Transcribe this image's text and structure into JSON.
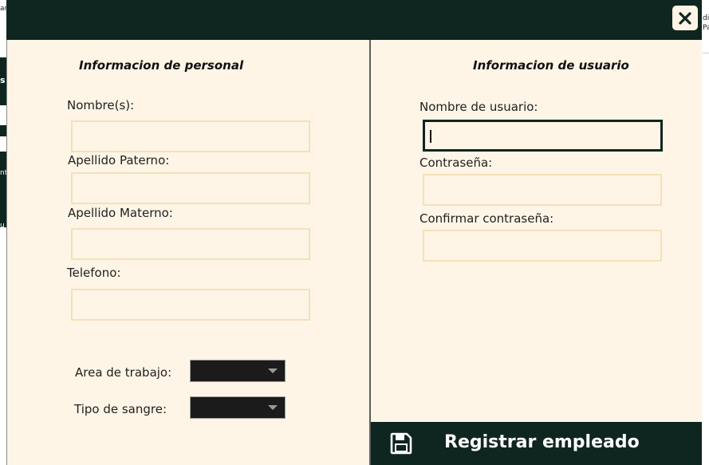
{
  "background": {
    "snippets": [
      "ar",
      "di",
      "Pa",
      "s",
      "nt",
      "u"
    ]
  },
  "modal": {
    "close_icon": "close-icon",
    "personal": {
      "title": "Informacion de personal",
      "nombre_label": "Nombre(s):",
      "nombre_value": "",
      "apellido_paterno_label": "Apellido Paterno:",
      "apellido_paterno_value": "",
      "apellido_materno_label": "Apellido Materno:",
      "apellido_materno_value": "",
      "telefono_label": "Telefono:",
      "telefono_value": "",
      "area_label": "Area de trabajo:",
      "area_selected": "",
      "sangre_label": "Tipo de sangre:",
      "sangre_selected": ""
    },
    "usuario": {
      "title": "Informacion de usuario",
      "username_label": "Nombre de usuario:",
      "username_value": "",
      "password_label": "Contraseña:",
      "password_value": "",
      "confirm_label": "Confirmar contraseña:",
      "confirm_value": ""
    },
    "register_button": {
      "label": "Registrar empleado",
      "icon": "save-icon"
    }
  },
  "colors": {
    "header": "#0f2620",
    "panel": "#fef5e6",
    "field_border": "#f6e0b8"
  }
}
